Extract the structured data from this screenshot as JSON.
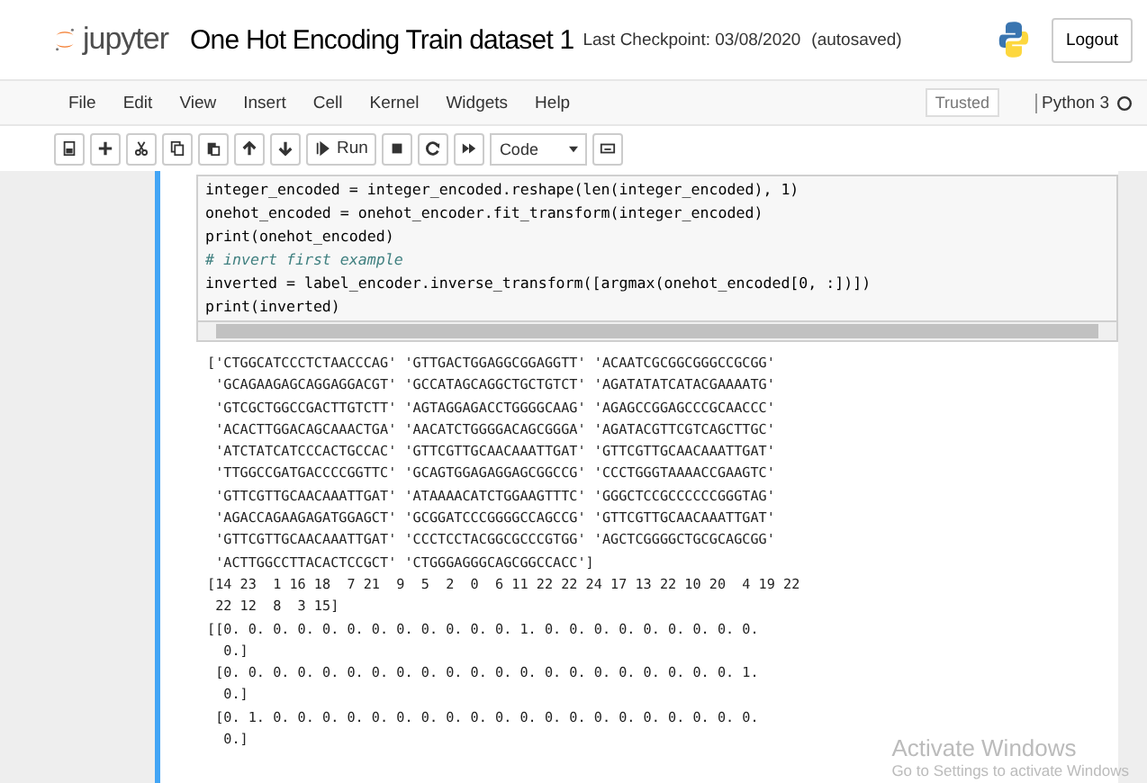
{
  "header": {
    "logo_text": "jupyter",
    "notebook_title": "One Hot Encoding Train dataset 1",
    "checkpoint": "Last Checkpoint: 03/08/2020",
    "autosave": "(autosaved)",
    "logout": "Logout"
  },
  "menu": [
    "File",
    "Edit",
    "View",
    "Insert",
    "Cell",
    "Kernel",
    "Widgets",
    "Help"
  ],
  "trusted": "Trusted",
  "kernel": "Python 3",
  "toolbar": [
    {
      "kind": "save"
    },
    {
      "kind": "plus"
    },
    {
      "kind": "cut"
    },
    {
      "kind": "copy"
    },
    {
      "kind": "paste"
    },
    {
      "kind": "up"
    },
    {
      "kind": "down"
    },
    {
      "kind": "run",
      "label": "Run"
    },
    {
      "kind": "stop"
    },
    {
      "kind": "restart"
    },
    {
      "kind": "fastforward"
    }
  ],
  "cell_type": "Code",
  "code_lines": [
    {
      "kind": "code",
      "text": "integer_encoded = integer_encoded.reshape(len(integer_encoded), 1)"
    },
    {
      "kind": "code",
      "text": "onehot_encoded = onehot_encoder.fit_transform(integer_encoded)"
    },
    {
      "kind": "code",
      "text": "print(onehot_encoded)"
    },
    {
      "kind": "comment",
      "text": "# invert first example"
    },
    {
      "kind": "code",
      "text": "inverted = label_encoder.inverse_transform([argmax(onehot_encoded[0, :])])"
    },
    {
      "kind": "code",
      "text": "print(inverted)"
    }
  ],
  "output_lines": [
    "['CTGGCATCCCTCTAACCCAG' 'GTTGACTGGAGGCGGAGGTT' 'ACAATCGCGGCGGGCCGCGG'",
    " 'GCAGAAGAGCAGGAGGACGT' 'GCCATAGCAGGCTGCTGTCT' 'AGATATATCATACGAAAATG'",
    " 'GTCGCTGGCCGACTTGTCTT' 'AGTAGGAGACCTGGGGCAAG' 'AGAGCCGGAGCCCGCAACCC'",
    " 'ACACTTGGACAGCAAACTGA' 'AACATCTGGGGACAGCGGGA' 'AGATACGTTCGTCAGCTTGC'",
    " 'ATCTATCATCCCACTGCCAC' 'GTTCGTTGCAACAAATTGAT' 'GTTCGTTGCAACAAATTGAT'",
    " 'TTGGCCGATGACCCCGGTTC' 'GCAGTGGAGAGGAGCGGCCG' 'CCCTGGGTAAAACCGAAGTC'",
    " 'GTTCGTTGCAACAAATTGAT' 'ATAAAACATCTGGAAGTTTC' 'GGGCTCCGCCCCCCGGGTAG'",
    " 'AGACCAGAAGAGATGGAGCT' 'GCGGATCCCGGGGCCAGCCG' 'GTTCGTTGCAACAAATTGAT'",
    " 'GTTCGTTGCAACAAATTGAT' 'CCCTCCTACGGCGCCCGTGG' 'AGCTCGGGGCTGCGCAGCGG'",
    " 'ACTTGGCCTTACACTCCGCT' 'CTGGGAGGGCAGCGGCCACC']",
    "[14 23  1 16 18  7 21  9  5  2  0  6 11 22 22 24 17 13 22 10 20  4 19 22",
    " 22 12  8  3 15]",
    "[[0. 0. 0. 0. 0. 0. 0. 0. 0. 0. 0. 0. 1. 0. 0. 0. 0. 0. 0. 0. 0. 0.",
    "  0.]",
    " [0. 0. 0. 0. 0. 0. 0. 0. 0. 0. 0. 0. 0. 0. 0. 0. 0. 0. 0. 0. 0. 1.",
    "  0.]",
    " [0. 1. 0. 0. 0. 0. 0. 0. 0. 0. 0. 0. 0. 0. 0. 0. 0. 0. 0. 0. 0. 0.",
    "  0.]"
  ],
  "activation": {
    "title": "Activate Windows",
    "subtitle": "Go to Settings to activate Windows"
  }
}
